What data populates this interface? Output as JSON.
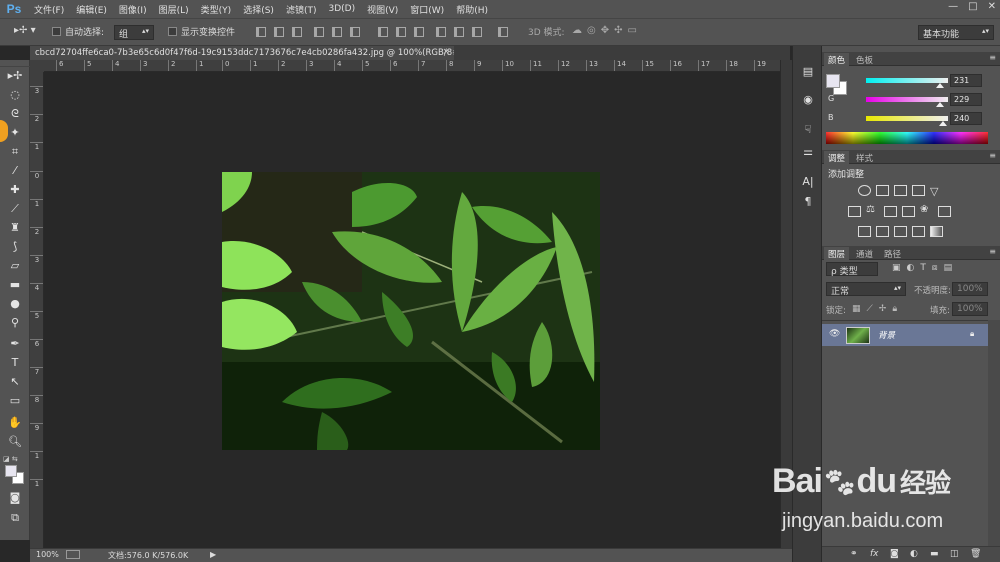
{
  "app": {
    "logo": "Ps",
    "menu": [
      "文件(F)",
      "编辑(E)",
      "图像(I)",
      "图层(L)",
      "类型(Y)",
      "选择(S)",
      "滤镜(T)",
      "3D(D)",
      "视图(V)",
      "窗口(W)",
      "帮助(H)"
    ],
    "window_controls": [
      "—",
      "□",
      "✕"
    ]
  },
  "options_bar": {
    "auto_select_label": "自动选择:",
    "auto_select_value": "组",
    "show_transform_label": "显示变换控件",
    "mode_3d_label": "3D 模式:",
    "workspace_value": "基本功能"
  },
  "document": {
    "tab_title": "cbcd72704ffe6ca0-7b3e65c6d0f47f6d-19c9153ddc7173676c7e4cb0286fa432.jpg @ 100%(RGB/8#)",
    "close": "×"
  },
  "ruler": {
    "top_ticks": [
      "6",
      "5",
      "4",
      "3",
      "2",
      "1",
      "0",
      "1",
      "2",
      "3",
      "4",
      "5",
      "6",
      "7",
      "8",
      "9",
      "10",
      "11",
      "12",
      "13",
      "14",
      "15",
      "16",
      "17",
      "18",
      "19"
    ],
    "left_ticks": [
      "3",
      "2",
      "1",
      "0",
      "1",
      "2",
      "3",
      "4",
      "5",
      "6",
      "7",
      "8",
      "9",
      "1",
      "1"
    ]
  },
  "status": {
    "zoom": "100%",
    "doc_info": "文档:576.0 K/576.0K",
    "arrow": "▶"
  },
  "color_panel": {
    "tabs": [
      "颜色",
      "色板"
    ],
    "channels": [
      {
        "label": "R",
        "value": "231",
        "gradient_from": "#00f0f0",
        "gradient_to": "#f0f0f0"
      },
      {
        "label": "G",
        "value": "229",
        "gradient_from": "#e800e8",
        "gradient_to": "#f0f0f0"
      },
      {
        "label": "B",
        "value": "240",
        "gradient_from": "#e8e800",
        "gradient_to": "#f0f0f0"
      }
    ],
    "foreground": "#e7e5f0"
  },
  "adjust_panel": {
    "tabs": [
      "调整",
      "样式"
    ],
    "title": "添加调整"
  },
  "layers_panel": {
    "tabs": [
      "图层",
      "通道",
      "路径"
    ],
    "filter_label": "ρ 类型",
    "blend_mode": "正常",
    "opacity_label": "不透明度:",
    "opacity_value": "100%",
    "lock_label": "锁定:",
    "fill_label": "填充:",
    "fill_value": "100%",
    "layer_name": "背景"
  },
  "watermark": {
    "brand": "Bai",
    "brand2": "du",
    "jingyan": "经验",
    "url": "jingyan.baidu.com"
  }
}
